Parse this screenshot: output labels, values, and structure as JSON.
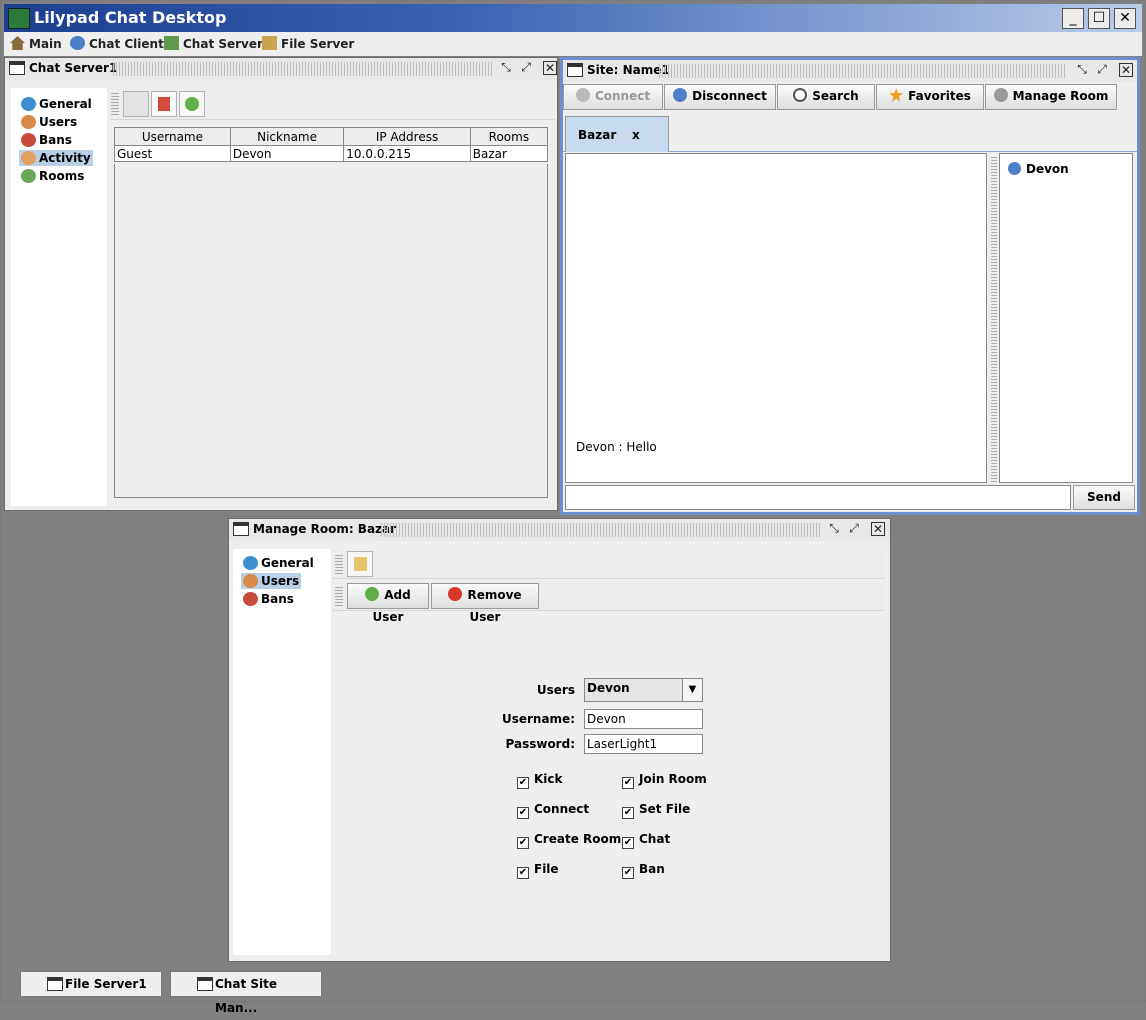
{
  "app": {
    "title": "Lilypad Chat Desktop"
  },
  "window_controls": {
    "minimize": "_",
    "maximize": "☐",
    "close": "✕"
  },
  "menu": [
    {
      "label": "Main"
    },
    {
      "label": "Chat Client"
    },
    {
      "label": "Chat Server"
    },
    {
      "label": "File Server"
    }
  ],
  "chat_server": {
    "title": "Chat Server1",
    "tree": [
      "General",
      "Users",
      "Bans",
      "Activity",
      "Rooms"
    ],
    "selected": "Activity",
    "columns": [
      "Username",
      "Nickname",
      "IP Address",
      "Rooms"
    ],
    "rows": [
      [
        "Guest",
        "Devon",
        "10.0.0.215",
        "Bazar"
      ]
    ]
  },
  "site": {
    "title": "Site: Name1",
    "toolbar": [
      "Connect",
      "Disconnect",
      "Search",
      "Favorites",
      "Manage Room"
    ],
    "tab": {
      "label": "Bazar",
      "close": "x"
    },
    "messages": [
      "Devon : Hello"
    ],
    "users": [
      "Devon"
    ],
    "send_label": "Send",
    "message_input": ""
  },
  "manage_room": {
    "title": "Manage Room: Bazar",
    "tree": [
      "General",
      "Users",
      "Bans"
    ],
    "selected": "Users",
    "add_user": "Add User",
    "remove_user": "Remove User",
    "users_label": "Users",
    "users_value": "Devon",
    "username_label": "Username:",
    "username_value": "Devon",
    "password_label": "Password:",
    "password_value": "LaserLight1",
    "permissions_left": [
      "Kick",
      "Connect",
      "Create Room",
      "File"
    ],
    "permissions_right": [
      "Join Room",
      "Set File",
      "Chat",
      "Ban"
    ],
    "check_mark": "✔"
  },
  "taskbar": [
    "File Server1",
    "Chat Site Man..."
  ],
  "colors": {
    "selection": "#b8cfe5",
    "title_gradient_start": "#1c3f8f",
    "active_border": "#6d8fd0"
  }
}
